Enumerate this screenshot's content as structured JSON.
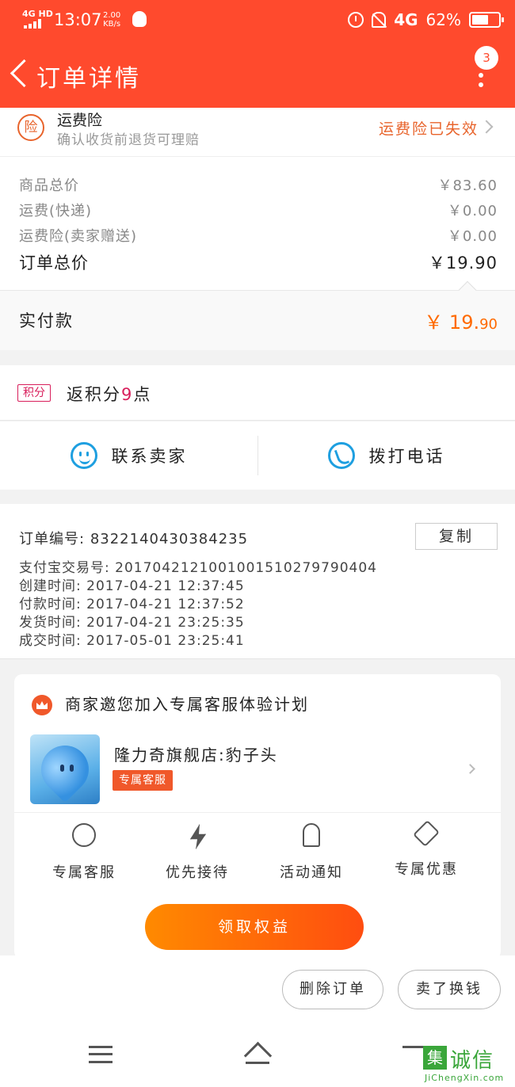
{
  "status_bar": {
    "network": "4G HD",
    "time": "13:07",
    "speed_value": "2.00",
    "speed_unit": "KB/s",
    "signal": "4G",
    "battery": "62%",
    "battery_level": 0.62
  },
  "header": {
    "title": "订单详情",
    "badge_count": "3"
  },
  "insurance": {
    "icon_char": "险",
    "title": "运费险",
    "subtitle": "确认收货前退货可理赔",
    "status": "运费险已失效"
  },
  "price": {
    "rows": [
      {
        "label": "商品总价",
        "value": "￥83.60"
      },
      {
        "label": "运费(快递)",
        "value": "￥0.00"
      },
      {
        "label": "运费险(卖家赠送)",
        "value": "￥0.00"
      }
    ],
    "total_label": "订单总价",
    "total_value": "￥19.90",
    "paid_label": "实付款",
    "paid_currency": "￥",
    "paid_main": "19.",
    "paid_decimal": "90"
  },
  "points": {
    "tag": "积分",
    "prefix": "返积分",
    "value": "9",
    "suffix": "点"
  },
  "contact": {
    "seller_label": "联系卖家",
    "call_label": "拨打电话"
  },
  "order": {
    "number_label": "订单编号:",
    "number": "8322140430384235",
    "copy_label": "复制",
    "lines": [
      {
        "label": "支付宝交易号:",
        "value": "2017042121001001510279790404"
      },
      {
        "label": "创建时间:",
        "value": "2017-04-21 12:37:45"
      },
      {
        "label": "付款时间:",
        "value": "2017-04-21 12:37:52"
      },
      {
        "label": "发货时间:",
        "value": "2017-04-21 23:25:35"
      },
      {
        "label": "成交时间:",
        "value": "2017-05-01 23:25:41"
      }
    ]
  },
  "service_card": {
    "heading": "商家邀您加入专属客服体验计划",
    "shop_name": "隆力奇旗舰店:豹子头",
    "shop_tag": "专属客服",
    "features": [
      {
        "label": "专属客服",
        "icon": "headset-icon"
      },
      {
        "label": "优先接待",
        "icon": "lightning-icon"
      },
      {
        "label": "活动通知",
        "icon": "bell-icon"
      },
      {
        "label": "专属优惠",
        "icon": "coupon-icon"
      }
    ],
    "claim_label": "领取权益"
  },
  "actions": {
    "delete_label": "删除订单",
    "sell_label": "卖了换钱"
  },
  "watermark": {
    "logo_char": "集",
    "big": "诚信",
    "small": "JiChengXin.com"
  },
  "colors": {
    "brand": "#ff4a2d",
    "accent_orange": "#ff6a00",
    "points_pink": "#d81e5b",
    "contact_blue": "#1e9fe0"
  }
}
